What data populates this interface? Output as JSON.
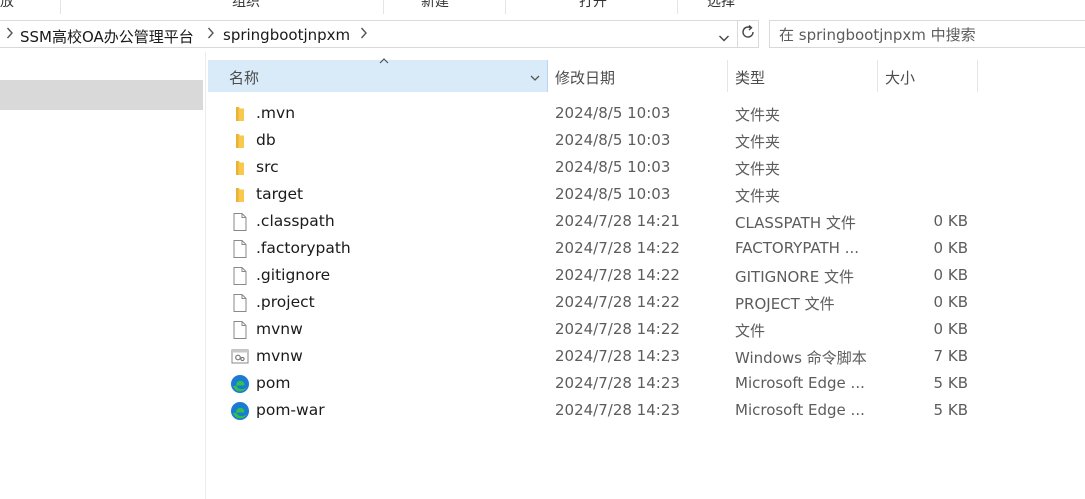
{
  "ribbon": {
    "groups": [
      "放",
      "组织",
      "新建",
      "打开",
      "选择"
    ]
  },
  "address": {
    "breadcrumbs": [
      "SSM高校OA办公管理平台",
      "springbootjnpxm"
    ]
  },
  "search": {
    "placeholder": "在 springbootjnpxm 中搜索"
  },
  "columns": {
    "name": "名称",
    "date": "修改日期",
    "type": "类型",
    "size": "大小"
  },
  "files": [
    {
      "name": ".mvn",
      "date": "2024/8/5 10:03",
      "type": "文件夹",
      "size": "",
      "icon": "folder-icon"
    },
    {
      "name": "db",
      "date": "2024/8/5 10:03",
      "type": "文件夹",
      "size": "",
      "icon": "folder-icon"
    },
    {
      "name": "src",
      "date": "2024/8/5 10:03",
      "type": "文件夹",
      "size": "",
      "icon": "folder-icon"
    },
    {
      "name": "target",
      "date": "2024/8/5 10:03",
      "type": "文件夹",
      "size": "",
      "icon": "folder-icon"
    },
    {
      "name": ".classpath",
      "date": "2024/7/28 14:21",
      "type": "CLASSPATH 文件",
      "size": "0 KB",
      "icon": "file-icon"
    },
    {
      "name": ".factorypath",
      "date": "2024/7/28 14:22",
      "type": "FACTORYPATH ...",
      "size": "0 KB",
      "icon": "file-icon"
    },
    {
      "name": ".gitignore",
      "date": "2024/7/28 14:22",
      "type": "GITIGNORE 文件",
      "size": "0 KB",
      "icon": "file-icon"
    },
    {
      "name": ".project",
      "date": "2024/7/28 14:22",
      "type": "PROJECT 文件",
      "size": "0 KB",
      "icon": "file-icon"
    },
    {
      "name": "mvnw",
      "date": "2024/7/28 14:22",
      "type": "文件",
      "size": "0 KB",
      "icon": "file-icon"
    },
    {
      "name": "mvnw",
      "date": "2024/7/28 14:23",
      "type": "Windows 命令脚本",
      "size": "7 KB",
      "icon": "script-icon"
    },
    {
      "name": "pom",
      "date": "2024/7/28 14:23",
      "type": "Microsoft Edge ...",
      "size": "5 KB",
      "icon": "edge-icon"
    },
    {
      "name": "pom-war",
      "date": "2024/7/28 14:23",
      "type": "Microsoft Edge ...",
      "size": "5 KB",
      "icon": "edge-icon"
    }
  ],
  "colors": {
    "folder": "#f8c94c",
    "header_selected": "#d9ebf9",
    "nav_selected": "#d9d9d9",
    "edge_blue": "#1a7bd4",
    "edge_green": "#35c04a"
  }
}
